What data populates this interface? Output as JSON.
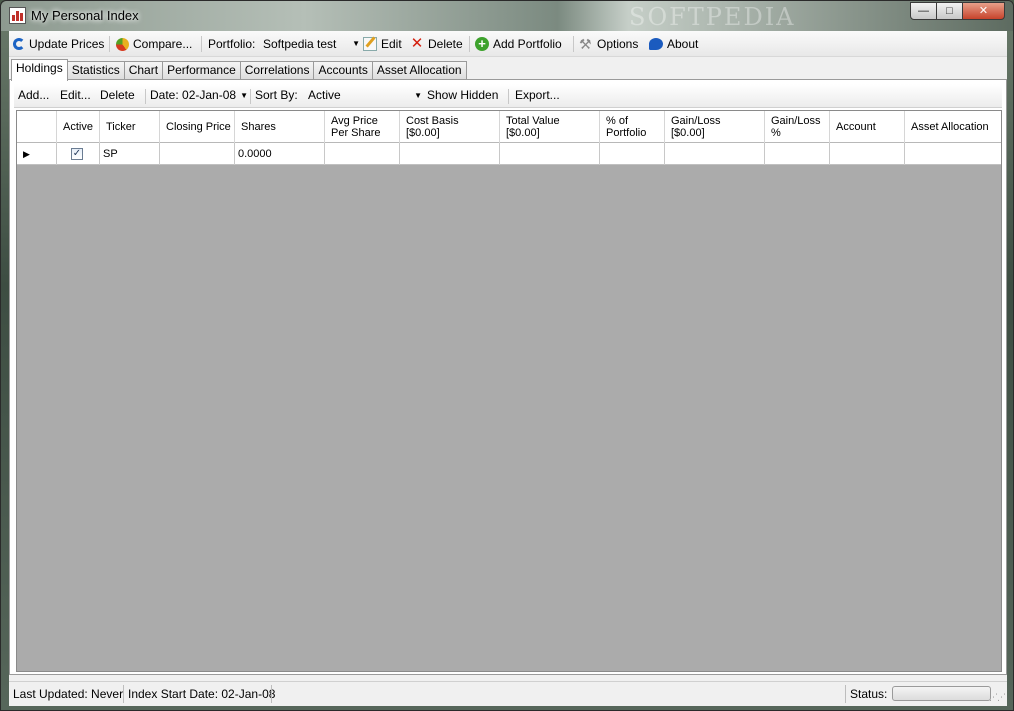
{
  "window": {
    "title": "My Personal Index",
    "watermark": "SOFTPEDIA",
    "controls": {
      "minimize": "—",
      "maximize": "□",
      "close": "✕"
    }
  },
  "toolbar": {
    "update_prices": "Update Prices",
    "compare": "Compare...",
    "portfolio_label": "Portfolio:",
    "portfolio_value": "Softpedia test",
    "edit": "Edit",
    "delete": "Delete",
    "add_portfolio": "Add Portfolio",
    "options": "Options",
    "about": "About"
  },
  "tabs": [
    {
      "label": "Holdings",
      "active": true
    },
    {
      "label": "Statistics"
    },
    {
      "label": "Chart"
    },
    {
      "label": "Performance"
    },
    {
      "label": "Correlations"
    },
    {
      "label": "Accounts"
    },
    {
      "label": "Asset Allocation"
    }
  ],
  "holdings_toolbar": {
    "add": "Add...",
    "edit": "Edit...",
    "delete": "Delete",
    "date": "Date: 02-Jan-08",
    "sort_by_label": "Sort By:",
    "sort_by_value": "Active",
    "show_hidden": "Show Hidden",
    "export": "Export..."
  },
  "grid": {
    "columns": [
      "",
      "Active",
      "Ticker",
      "Closing Price",
      "Shares",
      "Avg Price\nPer Share",
      "Cost Basis\n[$0.00]",
      "Total Value\n[$0.00]",
      "% of\nPortfolio",
      "Gain/Loss\n[$0.00]",
      "Gain/Loss\n%",
      "Account",
      "Asset Allocation"
    ],
    "rows": [
      {
        "marker": "▶",
        "active": "✓",
        "ticker": "SP",
        "closing_price": "",
        "shares": "0.0000",
        "avg_price": "",
        "cost_basis": "",
        "total_value": "",
        "pct_portfolio": "",
        "gain_loss": "",
        "gain_loss_pct": "",
        "account": "",
        "asset_allocation": ""
      }
    ]
  },
  "statusbar": {
    "last_updated": "Last Updated: Never",
    "index_start": "Index Start Date: 02-Jan-08",
    "status_label": "Status:",
    "progress": 0
  }
}
